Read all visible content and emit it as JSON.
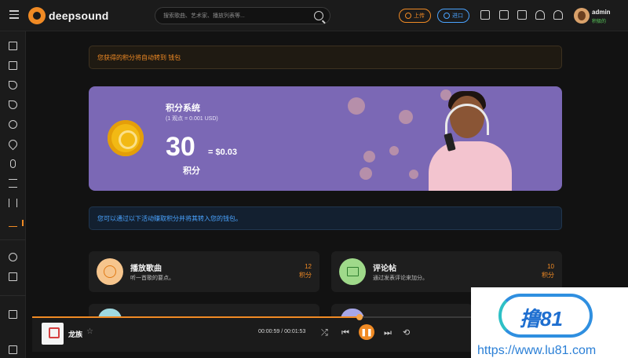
{
  "topbar": {
    "logo": "deepsound",
    "search_placeholder": "搜索歌曲、艺术家、播放列表等...",
    "upload_label": "上传",
    "import_label": "进口",
    "user": {
      "name": "admin",
      "status": "积极的"
    }
  },
  "notice_top": "您获得的积分将自动转到 钱包",
  "banner": {
    "title": "积分系统",
    "subtitle": "(1 观点 = 0.001 USD)",
    "points": "30",
    "equals": "= $0.03",
    "unit": "积分"
  },
  "notice_info": "您可以通过以下活动赚取积分并将其转入您的钱包。",
  "cards": [
    {
      "title": "播放歌曲",
      "desc": "听一首歌的要点。",
      "points": "12",
      "unit": "积分",
      "icon": "play-icon"
    },
    {
      "title": "评论帖",
      "desc": "通过发表评论来加分。",
      "points": "10",
      "unit": "积分",
      "icon": "comment-icon"
    }
  ],
  "player": {
    "song": "龙族",
    "elapsed": "00:00:59",
    "duration": "00:01:53",
    "progress": 0.55
  },
  "watermark": {
    "brand": "撸81",
    "url": "https://www.lu81.com"
  },
  "colors": {
    "accent": "#f08a24",
    "info": "#4aa3ff",
    "banner": "#7b68b5"
  }
}
